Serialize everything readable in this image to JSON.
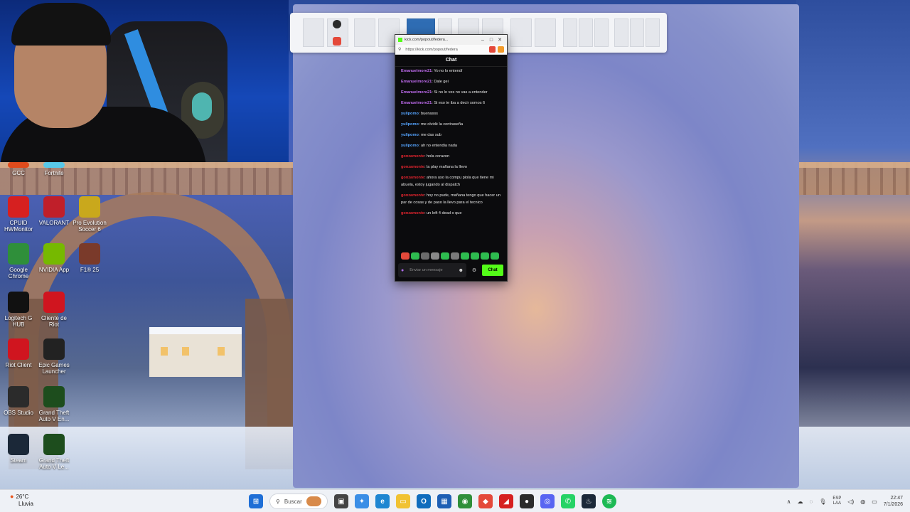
{
  "desktop": {
    "icons": [
      {
        "label": "GCC",
        "icon": "gcc-icon",
        "color": "#e04b1c"
      },
      {
        "label": "Fortnite",
        "icon": "fortnite-icon",
        "color": "#58c8e8"
      },
      {
        "label": "CPUID HWMonitor",
        "icon": "hwmonitor-icon",
        "color": "#d62020"
      },
      {
        "label": "VALORANT",
        "icon": "valorant-icon",
        "color": "#c01f2a"
      },
      {
        "label": "Pro Evolution Soccer 6",
        "icon": "pes-icon",
        "color": "#c9a81c"
      },
      {
        "label": "Google Chrome",
        "icon": "chrome-icon",
        "color": "#2f8f3a"
      },
      {
        "label": "NVIDIA App",
        "icon": "nvidia-icon",
        "color": "#76b900"
      },
      {
        "label": "F1® 25",
        "icon": "f1-icon",
        "color": "#7a3a2a"
      },
      {
        "label": "Logitech G HUB",
        "icon": "ghub-icon",
        "color": "#111111"
      },
      {
        "label": "Cliente de Riot",
        "icon": "riot-icon",
        "color": "#d0151f"
      },
      {
        "label": "Riot Client",
        "icon": "riot-client-icon",
        "color": "#d0151f"
      },
      {
        "label": "Epic Games Launcher",
        "icon": "epic-icon",
        "color": "#222222"
      },
      {
        "label": "OBS Studio",
        "icon": "obs-icon",
        "color": "#2b2b2b"
      },
      {
        "label": "Grand Theft Auto V En...",
        "icon": "gta-icon",
        "color": "#1d4d1d"
      },
      {
        "label": "Steam",
        "icon": "steam-icon",
        "color": "#1b2838"
      },
      {
        "label": "Grand Theft Auto V Le...",
        "icon": "gta-legacy-icon",
        "color": "#1d4d1d"
      }
    ]
  },
  "chat_window": {
    "title": "kick.com/popout/federa...",
    "url": "https://kick.com/popout/federa",
    "header": "Chat",
    "messages": [
      {
        "user": "Emanuelmore21",
        "color": "#c06cf0",
        "text": ": Yo no lo entendí"
      },
      {
        "user": "Emanuelmore21",
        "color": "#c06cf0",
        "text": ": Dale gei"
      },
      {
        "user": "Emanuelmore21",
        "color": "#c06cf0",
        "text": ": Si no lo ves no vas a entender"
      },
      {
        "user": "Emanuelmore21",
        "color": "#c06cf0",
        "text": ": Si eso te iba a decir somos 6"
      },
      {
        "user": "yulipomo",
        "color": "#55a4ff",
        "text": ": buenasss"
      },
      {
        "user": "yulipomo",
        "color": "#55a4ff",
        "text": ": me olvidé la contraseña"
      },
      {
        "user": "yulipomo",
        "color": "#55a4ff",
        "text": ": me das sub"
      },
      {
        "user": "yulipomo",
        "color": "#55a4ff",
        "text": ": ah no entendia nada"
      },
      {
        "user": "gonzamonte",
        "color": "#e0242e",
        "text": ": hola corazon"
      },
      {
        "user": "gonzamonte",
        "color": "#e0242e",
        "text": ": la play mañana la llevo"
      },
      {
        "user": "gonzamonte",
        "color": "#e0242e",
        "text": ": ahora uso la compu piola que tiene mi abuela, estoy jugando al dispatch"
      },
      {
        "user": "gonzamonte",
        "color": "#e0242e",
        "text": ": hoy no pude, mañana tengo que hacer un par de cosas y de paso la llevo para el tecnico"
      },
      {
        "user": "gonzamonte",
        "color": "#e0242e",
        "text": ": un left 4 dead o que"
      }
    ],
    "input_placeholder": "Enviar un mensaje",
    "send_label": "Chat"
  },
  "taskbar": {
    "weather_temp": "26°C",
    "weather_desc": "Lluvia",
    "search_placeholder": "Buscar",
    "lang_top": "ESP",
    "lang_bottom": "LAA",
    "time": "22:47",
    "date": "7/1/2026"
  }
}
